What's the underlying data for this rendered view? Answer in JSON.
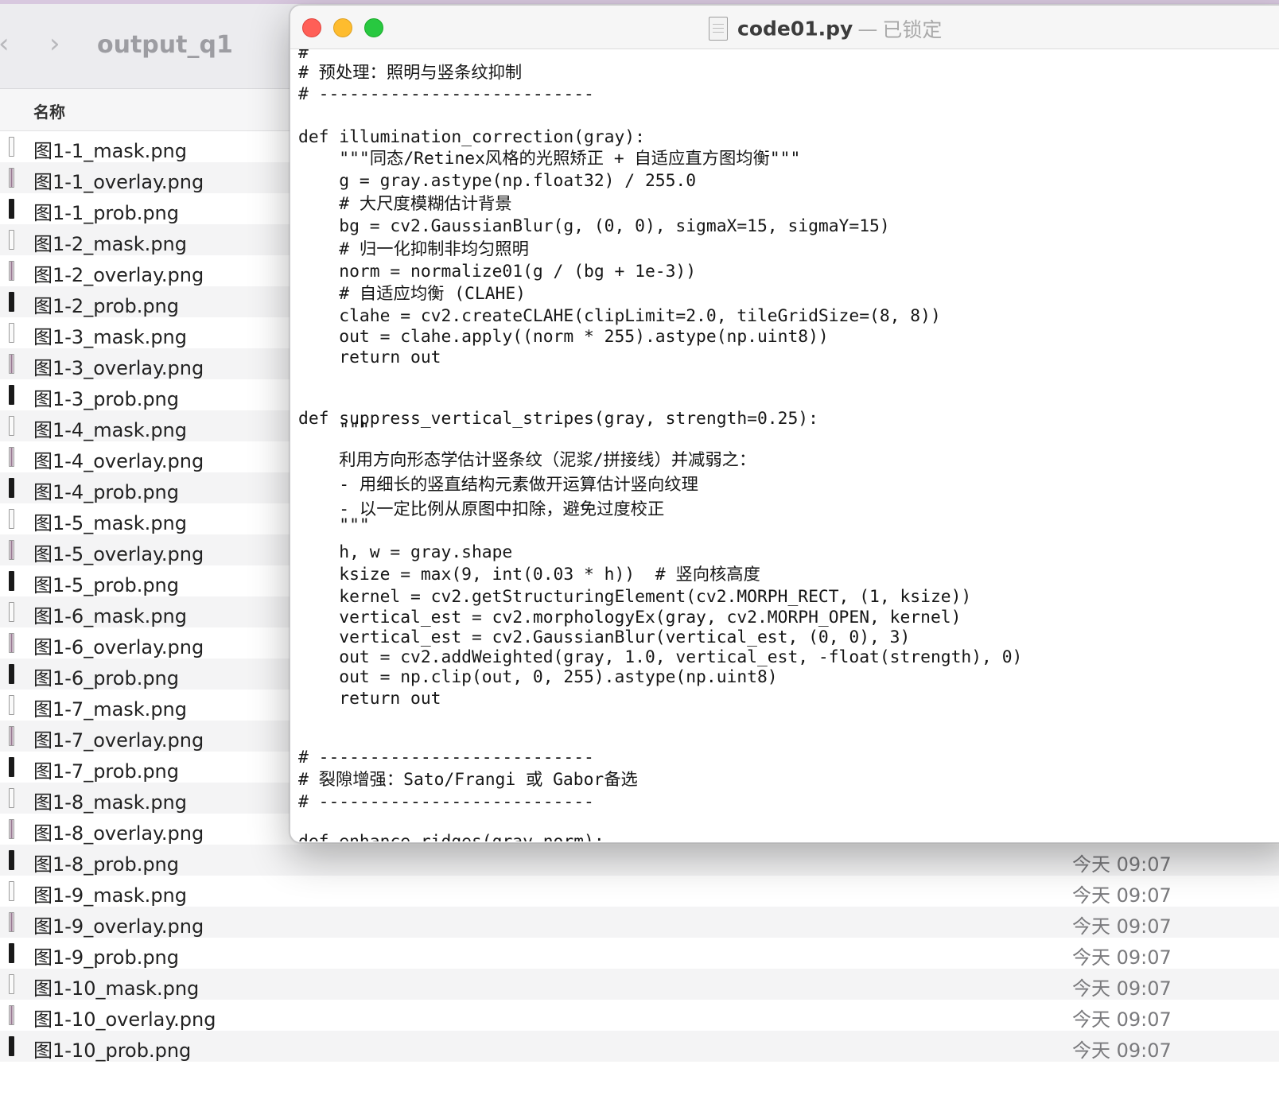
{
  "finder": {
    "back_glyph": "‹",
    "forward_glyph": "›",
    "folder_title": "output_q1",
    "column_name": "名称",
    "files": [
      {
        "name": "图1-1_mask.png",
        "date": "",
        "icon": "mask"
      },
      {
        "name": "图1-1_overlay.png",
        "date": "",
        "icon": "overlay"
      },
      {
        "name": "图1-1_prob.png",
        "date": "",
        "icon": "prob"
      },
      {
        "name": "图1-2_mask.png",
        "date": "",
        "icon": "mask"
      },
      {
        "name": "图1-2_overlay.png",
        "date": "",
        "icon": "overlay"
      },
      {
        "name": "图1-2_prob.png",
        "date": "",
        "icon": "prob"
      },
      {
        "name": "图1-3_mask.png",
        "date": "",
        "icon": "mask"
      },
      {
        "name": "图1-3_overlay.png",
        "date": "",
        "icon": "overlay"
      },
      {
        "name": "图1-3_prob.png",
        "date": "",
        "icon": "prob"
      },
      {
        "name": "图1-4_mask.png",
        "date": "",
        "icon": "mask"
      },
      {
        "name": "图1-4_overlay.png",
        "date": "",
        "icon": "overlay"
      },
      {
        "name": "图1-4_prob.png",
        "date": "",
        "icon": "prob"
      },
      {
        "name": "图1-5_mask.png",
        "date": "",
        "icon": "mask"
      },
      {
        "name": "图1-5_overlay.png",
        "date": "",
        "icon": "overlay"
      },
      {
        "name": "图1-5_prob.png",
        "date": "",
        "icon": "prob"
      },
      {
        "name": "图1-6_mask.png",
        "date": "",
        "icon": "mask"
      },
      {
        "name": "图1-6_overlay.png",
        "date": "",
        "icon": "overlay"
      },
      {
        "name": "图1-6_prob.png",
        "date": "",
        "icon": "prob"
      },
      {
        "name": "图1-7_mask.png",
        "date": "",
        "icon": "mask"
      },
      {
        "name": "图1-7_overlay.png",
        "date": "",
        "icon": "overlay"
      },
      {
        "name": "图1-7_prob.png",
        "date": "",
        "icon": "prob"
      },
      {
        "name": "图1-8_mask.png",
        "date": "",
        "icon": "mask"
      },
      {
        "name": "图1-8_overlay.png",
        "date": "",
        "icon": "overlay"
      },
      {
        "name": "图1-8_prob.png",
        "date": "今天 09:07",
        "icon": "prob"
      },
      {
        "name": "图1-9_mask.png",
        "date": "今天 09:07",
        "icon": "mask"
      },
      {
        "name": "图1-9_overlay.png",
        "date": "今天 09:07",
        "icon": "overlay"
      },
      {
        "name": "图1-9_prob.png",
        "date": "今天 09:07",
        "icon": "prob"
      },
      {
        "name": "图1-10_mask.png",
        "date": "今天 09:07",
        "icon": "mask"
      },
      {
        "name": "图1-10_overlay.png",
        "date": "今天 09:07",
        "icon": "overlay"
      },
      {
        "name": "图1-10_prob.png",
        "date": "今天 09:07",
        "icon": "prob"
      }
    ]
  },
  "editor": {
    "file_name": "code01.py",
    "separator": "—",
    "lock_status": "已锁定",
    "code_lines": [
      {
        "text": "#"
      },
      {
        "text": "# 预处理：照明与竖条纹抑制"
      },
      {
        "text": "# ---------------------------"
      },
      {
        "text": ""
      },
      {
        "text": "def illumination_correction(gray):"
      },
      {
        "text": "    \"\"\"同态/Retinex风格的光照矫正 + 自适应直方图均衡\"\"\""
      },
      {
        "text": "    g = gray.astype(np.float32) / 255.0"
      },
      {
        "text": "    # 大尺度模糊估计背景"
      },
      {
        "text": "    bg = cv2.GaussianBlur(g, (0, 0), sigmaX=15, sigmaY=15)"
      },
      {
        "text": "    # 归一化抑制非均匀照明"
      },
      {
        "text": "    norm = normalize01(g / (bg + 1e-3))"
      },
      {
        "text": "    # 自适应均衡 (CLAHE)"
      },
      {
        "text": "    clahe = cv2.createCLAHE(clipLimit=2.0, tileGridSize=(8, 8))"
      },
      {
        "text": "    out = clahe.apply((norm * 255).astype(np.uint8))"
      },
      {
        "text": "    return out"
      },
      {
        "text": ""
      },
      {
        "text": ""
      },
      {
        "text": "def suppress_vertical_stripes(gray, strength=0.25):"
      },
      {
        "text": "    \"\"\""
      },
      {
        "text": "    利用方向形态学估计竖条纹（泥浆/拼接线）并减弱之："
      },
      {
        "text": "    - 用细长的竖直结构元素做开运算估计竖向纹理"
      },
      {
        "text": "    - 以一定比例从原图中扣除，避免过度校正"
      },
      {
        "text": "    \"\"\""
      },
      {
        "text": "    h, w = gray.shape"
      },
      {
        "text": "    ksize = max(9, int(0.03 * h))  # 竖向核高度"
      },
      {
        "text": "    kernel = cv2.getStructuringElement(cv2.MORPH_RECT, (1, ksize))"
      },
      {
        "text": "    vertical_est = cv2.morphologyEx(gray, cv2.MORPH_OPEN, kernel)"
      },
      {
        "text": "    vertical_est = cv2.GaussianBlur(vertical_est, (0, 0), 3)"
      },
      {
        "text": "    out = cv2.addWeighted(gray, 1.0, vertical_est, -float(strength), 0)"
      },
      {
        "text": "    out = np.clip(out, 0, 255).astype(np.uint8)"
      },
      {
        "text": "    return out"
      },
      {
        "text": ""
      },
      {
        "text": ""
      },
      {
        "text": "# ---------------------------"
      },
      {
        "text": "# 裂隙增强：Sato/Frangi 或 Gabor备选"
      },
      {
        "text": "# ---------------------------"
      },
      {
        "text": ""
      },
      {
        "text": "def enhance_ridges(gray_norm):"
      }
    ]
  },
  "colors": {
    "close": "#ff5f57",
    "minimize": "#febc2e",
    "maximize": "#28c840",
    "row_alt": "#f4f4f5",
    "date_text": "#7a7a7d"
  }
}
